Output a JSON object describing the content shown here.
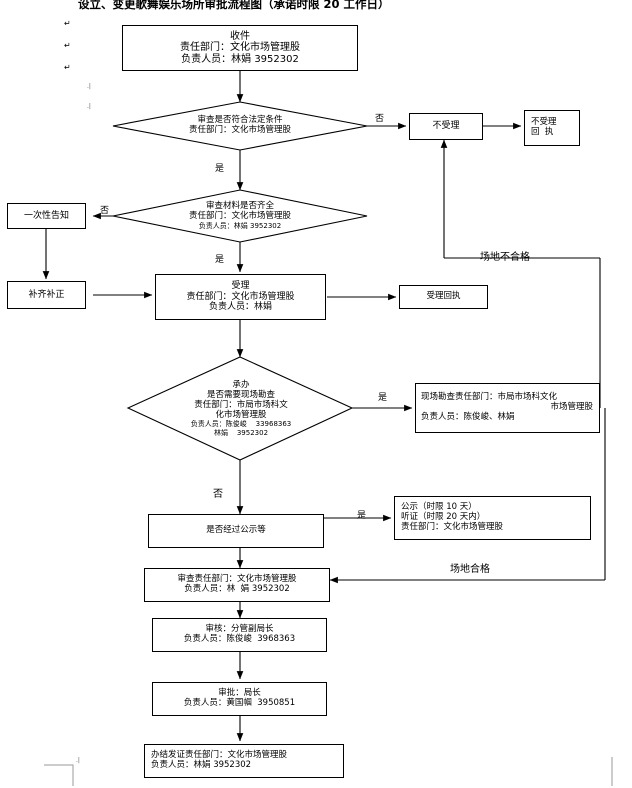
{
  "document": {
    "title": "设立、变更歌舞娱乐场所审批流程图（承诺时限 20 工作日）",
    "title_suffix": "↵"
  },
  "margin_marks": {
    "pilcrows": [
      "↵",
      "↵",
      "↵"
    ],
    "dots": [
      ".|",
      ".|"
    ],
    "corner_dot": ".|"
  },
  "nodes": {
    "receive": {
      "name": "收件",
      "line1": "收件",
      "line2": "责任部门：文化市场管理股",
      "line3": "负责人员：林娟 3952302"
    },
    "check_legal": {
      "line1": "审查是否符合法定条件",
      "line2": "责任部门：文化市场管理股"
    },
    "not_accept": {
      "line1": "不受理"
    },
    "not_accept_receipt": {
      "line1": "不受理",
      "line2": "回  执"
    },
    "check_materials": {
      "line1": "审查材料是否齐全",
      "line2": "责任部门：文化市场管理股",
      "line3": "负责人员：林娟 3952302"
    },
    "one_time_notice": {
      "line1": "一次性告知"
    },
    "supplement": {
      "line1": "补齐补正"
    },
    "accept": {
      "line1": "受理",
      "line2": "责任部门：文化市场管理股",
      "line3": "负责人员：林娟"
    },
    "accept_receipt": {
      "line1": "受理回执"
    },
    "undertake": {
      "line1": "承办",
      "line2": "是否需要现场勘查",
      "line3": "责任部门：市局市场科文",
      "line4": "化市场管理股",
      "line5": "负责人员：陈俊峻    33968363",
      "line6": "林娟    3952302"
    },
    "site_survey": {
      "line1": "现场勘查责任部门：市局市场科文化",
      "line2": "市场管理股",
      "line3": "负责人员：陈俊峻、林娟"
    },
    "publicity_check": {
      "line1": "是否经过公示等"
    },
    "publicity": {
      "line1": "公示（时限 10 天）",
      "line2": "听证（时限 20 天内）",
      "line3": "责任部门：文化市场管理股"
    },
    "review_dept": {
      "line1": "审查责任部门：文化市场管理股",
      "line2": "负责人员：林  娟 3952302"
    },
    "audit": {
      "line1": "审核：分管副局长",
      "line2": "负责人员：陈俊峻  3968363"
    },
    "approve": {
      "line1": "审批：局长",
      "line2": "负责人员：黄国帼  3950851"
    },
    "issue": {
      "line1": "办结发证责任部门：文化市场管理股",
      "line2": "负责人员：林娟 3952302"
    }
  },
  "edge_labels": {
    "no_1": "否",
    "yes_1": "是",
    "no_2": "否",
    "yes_2": "是",
    "yes_3": "是",
    "no_3": "否",
    "yes_4": "是",
    "site_fail": "场地不合格",
    "site_pass": "场地合格"
  }
}
